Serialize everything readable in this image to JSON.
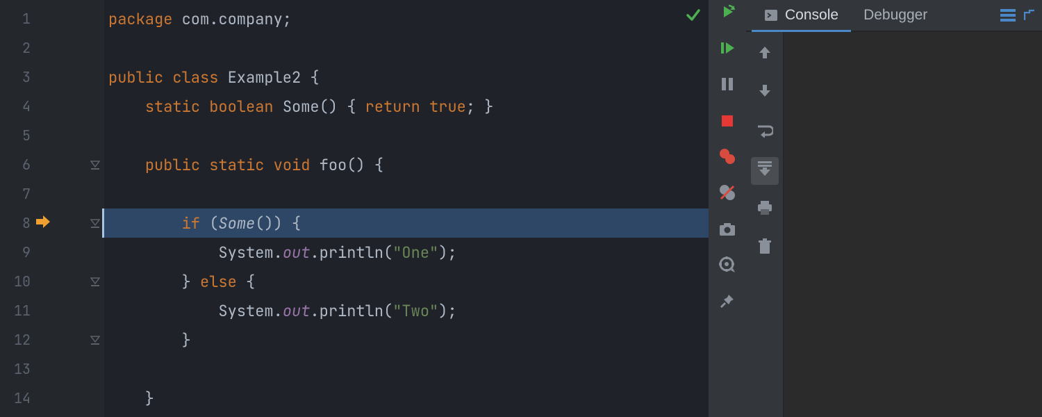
{
  "editor": {
    "lines": [
      {
        "n": 1,
        "tokens": [
          {
            "t": "package ",
            "c": "kw"
          },
          {
            "t": "com.company;",
            "c": "plain"
          }
        ]
      },
      {
        "n": 2,
        "tokens": []
      },
      {
        "n": 3,
        "tokens": [
          {
            "t": "public class ",
            "c": "kw"
          },
          {
            "t": "Example2 {",
            "c": "plain"
          }
        ]
      },
      {
        "n": 4,
        "tokens": [
          {
            "t": "    ",
            "c": "plain"
          },
          {
            "t": "static boolean ",
            "c": "kw"
          },
          {
            "t": "Some",
            "c": "plain"
          },
          {
            "t": "() { ",
            "c": "plain"
          },
          {
            "t": "return true",
            "c": "kw"
          },
          {
            "t": "; }",
            "c": "plain"
          }
        ]
      },
      {
        "n": 5,
        "tokens": []
      },
      {
        "n": 6,
        "fold": true,
        "tokens": [
          {
            "t": "    ",
            "c": "plain"
          },
          {
            "t": "public static void ",
            "c": "kw"
          },
          {
            "t": "foo",
            "c": "plain"
          },
          {
            "t": "() {",
            "c": "plain"
          }
        ]
      },
      {
        "n": 7,
        "tokens": []
      },
      {
        "n": 8,
        "hl": true,
        "arrow": true,
        "fold": true,
        "tokens": [
          {
            "t": "        ",
            "c": "plain"
          },
          {
            "t": "if ",
            "c": "kw"
          },
          {
            "t": "(",
            "c": "plain"
          },
          {
            "t": "Some",
            "c": "plain italic"
          },
          {
            "t": "()) {",
            "c": "plain"
          }
        ]
      },
      {
        "n": 9,
        "tokens": [
          {
            "t": "            System.",
            "c": "plain"
          },
          {
            "t": "out",
            "c": "stat"
          },
          {
            "t": ".println(",
            "c": "plain"
          },
          {
            "t": "\"One\"",
            "c": "str"
          },
          {
            "t": ");",
            "c": "plain"
          }
        ]
      },
      {
        "n": 10,
        "fold": true,
        "tokens": [
          {
            "t": "        } ",
            "c": "plain"
          },
          {
            "t": "else ",
            "c": "kw"
          },
          {
            "t": "{",
            "c": "plain"
          }
        ]
      },
      {
        "n": 11,
        "tokens": [
          {
            "t": "            System.",
            "c": "plain"
          },
          {
            "t": "out",
            "c": "stat"
          },
          {
            "t": ".println(",
            "c": "plain"
          },
          {
            "t": "\"Two\"",
            "c": "str"
          },
          {
            "t": ");",
            "c": "plain"
          }
        ]
      },
      {
        "n": 12,
        "fold": true,
        "tokens": [
          {
            "t": "        }",
            "c": "plain"
          }
        ]
      },
      {
        "n": 13,
        "tokens": []
      },
      {
        "n": 14,
        "tokens": [
          {
            "t": "    }",
            "c": "plain"
          }
        ]
      }
    ]
  },
  "run_toolbar": {
    "icons": [
      "rerun",
      "resume",
      "pause",
      "stop",
      "breakpoints",
      "mute-breakpoints",
      "camera",
      "settings",
      "pin"
    ]
  },
  "toolwindow": {
    "tabs": [
      {
        "label": "Console",
        "active": true
      },
      {
        "label": "Debugger",
        "active": false
      }
    ],
    "side_icons": [
      "up",
      "down",
      "wrap",
      "scroll-to-end",
      "print",
      "trash"
    ],
    "active_side_index": 3
  },
  "colors": {
    "exec_arrow": "#f0a030",
    "resume_green": "#4caf50",
    "stop_red": "#e53935",
    "bp_red": "#d94b3f",
    "grey": "#8a9099",
    "tab_underline": "#4a88c7"
  }
}
